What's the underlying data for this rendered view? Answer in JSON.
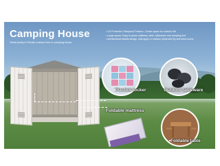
{
  "banner": {
    "title": "Camping House",
    "subtitle": "Great family in Private outdoor time in camping house.",
    "bullets": [
      "UV Protected, Rainproof Feature, Create space for outdoor life",
      "Large space, Easy to place mattress, table, tableware and camping tool",
      "Architectural details design, wall apply in outdoor presented by anti-wind screw"
    ],
    "features": [
      {
        "label": "Foldable mattress",
        "icon": "mattress-icon"
      },
      {
        "label": "Plastick locker",
        "icon": "locker-icon"
      },
      {
        "label": "Outdoor tableware",
        "icon": "tableware-icon"
      },
      {
        "label": "Foldable table",
        "icon": "table-icon"
      }
    ]
  },
  "colors": {
    "sky": "#7fa4cc",
    "grass": "#5d8c46",
    "shed_door": "#f1efec",
    "label_text": "#ffffff"
  }
}
